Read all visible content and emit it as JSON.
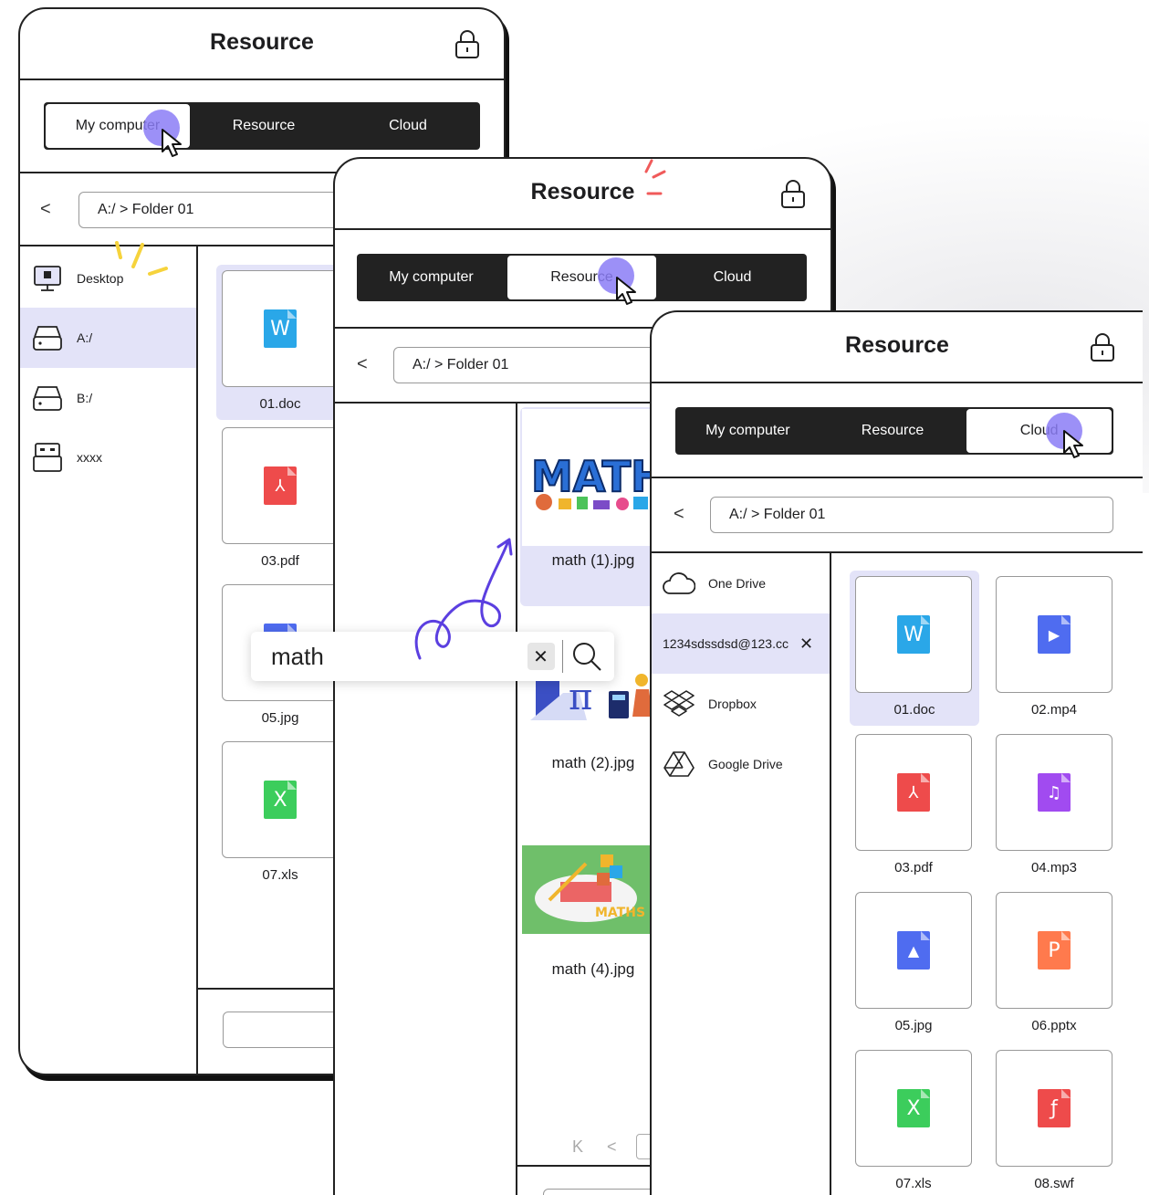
{
  "panels": {
    "my_computer": {
      "title": "Resource",
      "tabs": [
        "My computer",
        "Resource",
        "Cloud"
      ],
      "active_tab": "My computer",
      "path": "A:/ > Folder 01",
      "sidebar": [
        "Desktop",
        "A:/",
        "B:/",
        "xxxx"
      ],
      "selected_sidebar": "A:/",
      "files": [
        "01.doc",
        "03.pdf",
        "05.jpg",
        "07.xls"
      ]
    },
    "resource": {
      "title": "Resource",
      "tabs": [
        "My computer",
        "Resource",
        "Cloud"
      ],
      "active_tab": "Resource",
      "path": "A:/ > Folder 01",
      "results": [
        "math (1).jpg",
        "math (2).jpg",
        "math (4).jpg"
      ],
      "thumb_text": "MATH",
      "thumb_text_2": "MATHS"
    },
    "cloud": {
      "title": "Resource",
      "tabs": [
        "My computer",
        "Resource",
        "Cloud"
      ],
      "active_tab": "Cloud",
      "path": "A:/ > Folder 01",
      "sidebar": [
        "One Drive",
        "1234sdssdsd@123.cc",
        "Dropbox",
        "Google Drive"
      ],
      "selected_sidebar": "1234sdssdsd@123.cc",
      "files": [
        "01.doc",
        "02.mp4",
        "03.pdf",
        "04.mp3",
        "05.jpg",
        "06.pptx",
        "07.xls",
        "08.swf"
      ]
    }
  },
  "search": {
    "query": "math"
  },
  "icons": {
    "doc": {
      "color": "#2aa7e8",
      "glyph": "W"
    },
    "pdf": {
      "color": "#ee4b4b",
      "glyph": "⅄"
    },
    "jpg": {
      "color": "#4f6cf0",
      "glyph": "▲"
    },
    "xls": {
      "color": "#3ccd5c",
      "glyph": "X"
    },
    "mp4": {
      "color": "#4f6cf0",
      "glyph": "▶"
    },
    "mp3": {
      "color": "#a14bf0",
      "glyph": "♫"
    },
    "pptx": {
      "color": "#ff7a4d",
      "glyph": "P"
    },
    "swf": {
      "color": "#ee4b4b",
      "glyph": "ƒ"
    }
  },
  "colors": {
    "accent": "#8b7cf6",
    "selected_bg": "#e3e3f8",
    "dark": "#222222"
  }
}
